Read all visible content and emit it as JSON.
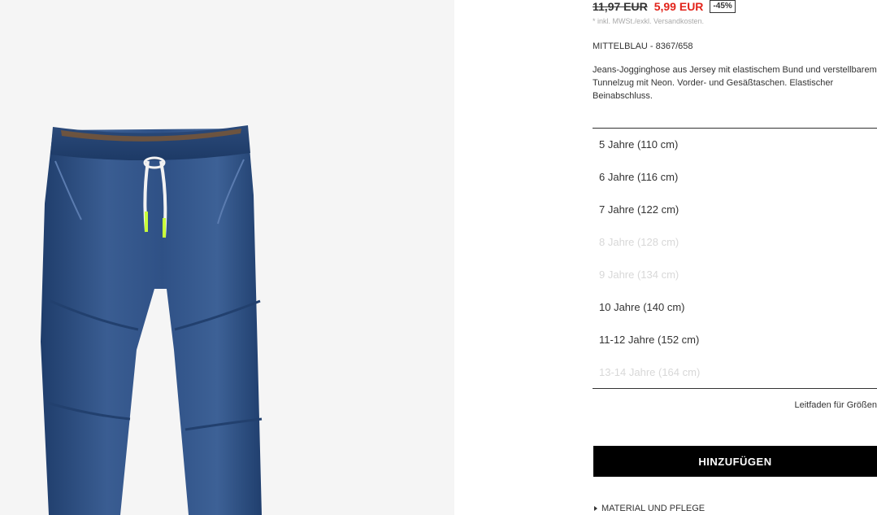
{
  "product": {
    "old_price": "11,97 EUR",
    "new_price": "5,99 EUR",
    "discount": "-45%",
    "tax_note": "* inkl. MWSt./exkl. Versandkosten.",
    "color_ref": "MITTELBLAU - 8367/658",
    "description": "Jeans-Jogginghose aus Jersey mit elastischem Bund und verstellbarem Tunnelzug mit Neon. Vorder- und Gesäßtaschen. Elastischer Beinabschluss.",
    "image_alt": "jeans-jogger-image"
  },
  "sizes": [
    {
      "label": "5 Jahre (110 cm)",
      "available": true
    },
    {
      "label": "6 Jahre (116 cm)",
      "available": true
    },
    {
      "label": "7 Jahre (122 cm)",
      "available": true
    },
    {
      "label": "8 Jahre (128 cm)",
      "available": false
    },
    {
      "label": "9 Jahre (134 cm)",
      "available": false
    },
    {
      "label": "10 Jahre (140 cm)",
      "available": true
    },
    {
      "label": "11-12 Jahre (152 cm)",
      "available": true
    },
    {
      "label": "13-14 Jahre (164 cm)",
      "available": false
    }
  ],
  "size_guide_label": "Leitfaden für Größen",
  "add_button_label": "HINZUFÜGEN",
  "material_label": "MATERIAL UND PFLEGE",
  "colors": {
    "sale_price": "#e2231a",
    "button_bg": "#000000",
    "disabled_size": "#d8d8d8",
    "denim": "#2c4d7e"
  },
  "icons": {
    "material_toggle": "caret-right-icon"
  }
}
